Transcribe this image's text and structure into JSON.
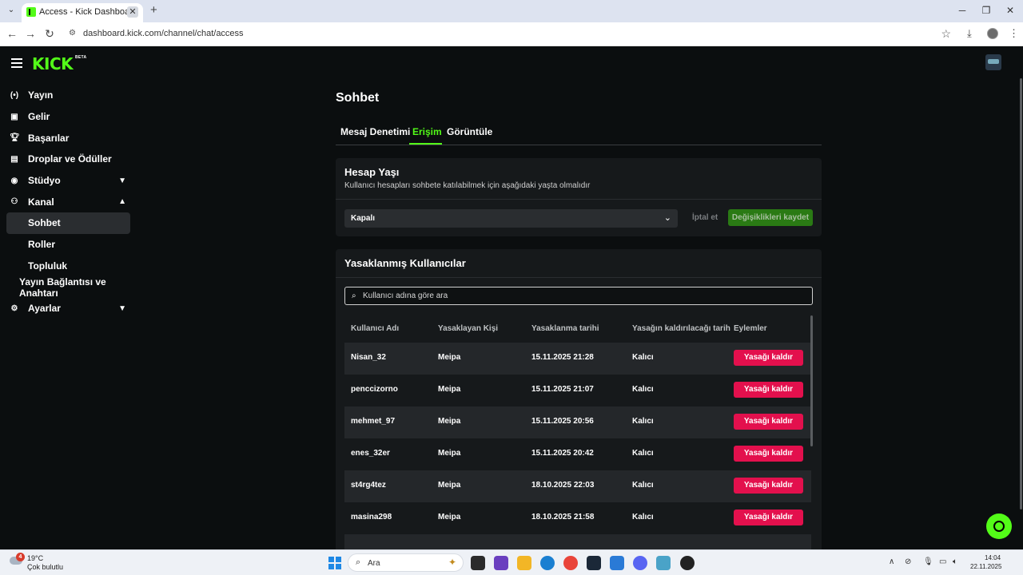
{
  "browser": {
    "tab_title": "Access - Kick Dashboard",
    "url": "dashboard.kick.com/channel/chat/access"
  },
  "header": {
    "logo": "KICK",
    "logo_badge": "BETA"
  },
  "sidebar": {
    "items": [
      {
        "label": "Yayın",
        "icon": "broadcast-icon"
      },
      {
        "label": "Gelir",
        "icon": "revenue-icon"
      },
      {
        "label": "Başarılar",
        "icon": "trophy-icon"
      },
      {
        "label": "Droplar ve Ödüller",
        "icon": "gift-icon"
      },
      {
        "label": "Stüdyo",
        "icon": "studio-icon"
      },
      {
        "label": "Kanal",
        "icon": "channel-icon"
      },
      {
        "label": "Sohbet"
      },
      {
        "label": "Roller"
      },
      {
        "label": "Topluluk"
      },
      {
        "label": "Yayın Bağlantısı ve Anahtarı"
      },
      {
        "label": "Ayarlar",
        "icon": "gear-icon"
      }
    ]
  },
  "page": {
    "title": "Sohbet",
    "tabs": [
      "Mesaj Denetimi",
      "Erişim",
      "Görüntüle"
    ],
    "active_tab": "Erişim"
  },
  "account_age": {
    "title": "Hesap Yaşı",
    "description": "Kullanıcı hesapları sohbete katılabilmek için aşağıdaki yaşta olmalıdır",
    "selected": "Kapalı",
    "cancel_label": "İptal et",
    "save_label": "Değişiklikleri kaydet"
  },
  "banned_users": {
    "title": "Yasaklanmış Kullanıcılar",
    "search_placeholder": "Kullanıcı adına göre ara",
    "columns": [
      "Kullanıcı Adı",
      "Yasaklayan Kişi",
      "Yasaklanma tarihi",
      "Yasağın kaldırılacağı tarih",
      "Eylemler"
    ],
    "rows": [
      {
        "username": "Nisan_32",
        "banned_by": "Meipa",
        "banned_at": "15.11.2025 21:28",
        "expires": "Kalıcı",
        "action": "Yasağı kaldır"
      },
      {
        "username": "penccizorno",
        "banned_by": "Meipa",
        "banned_at": "15.11.2025 21:07",
        "expires": "Kalıcı",
        "action": "Yasağı kaldır"
      },
      {
        "username": "mehmet_97",
        "banned_by": "Meipa",
        "banned_at": "15.11.2025 20:56",
        "expires": "Kalıcı",
        "action": "Yasağı kaldır"
      },
      {
        "username": "enes_32er",
        "banned_by": "Meipa",
        "banned_at": "15.11.2025 20:42",
        "expires": "Kalıcı",
        "action": "Yasağı kaldır"
      },
      {
        "username": "st4rg4tez",
        "banned_by": "Meipa",
        "banned_at": "18.10.2025 22:03",
        "expires": "Kalıcı",
        "action": "Yasağı kaldır"
      },
      {
        "username": "masina298",
        "banned_by": "Meipa",
        "banned_at": "18.10.2025 21:58",
        "expires": "Kalıcı",
        "action": "Yasağı kaldır"
      }
    ]
  },
  "taskbar": {
    "weather_badge": "4",
    "weather_temp": "19°C",
    "weather_desc": "Çok bulutlu",
    "search_text": "Ara",
    "time": "14:04",
    "date": "22.11.2025"
  },
  "colors": {
    "accent": "#53fc18",
    "danger": "#e3104d",
    "background": "#0b0e0f",
    "card": "#16191b"
  }
}
